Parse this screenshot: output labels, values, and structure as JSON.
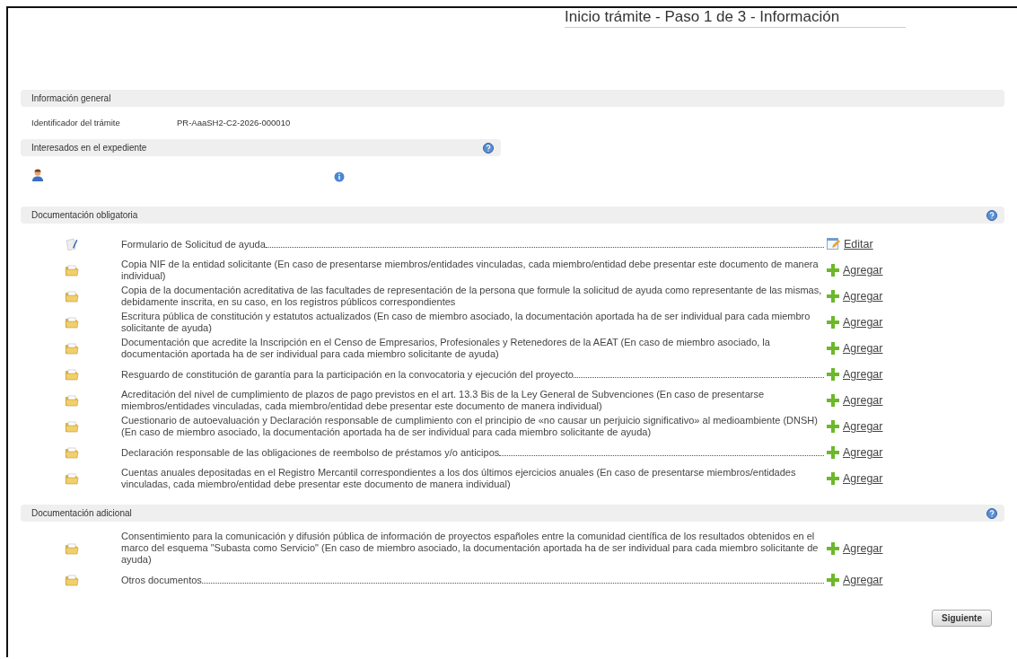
{
  "title": "Inicio trámite - Paso 1 de 3 - Información",
  "general": {
    "heading": "Información general",
    "fields": [
      {
        "label": "Identificador del trámite",
        "value": "PR-AaaSH2-C2-2026-000010"
      }
    ]
  },
  "interesados": {
    "heading": "Interesados en el expediente"
  },
  "sections": [
    {
      "heading": "Documentación obligatoria",
      "documents": [
        {
          "kind": "form",
          "text": "Formulario de Solicitud de ayuda",
          "action": {
            "kind": "edit",
            "label": "Editar"
          }
        },
        {
          "kind": "folder",
          "text": "Copia NIF de la entidad solicitante (En caso de presentarse miembros/entidades vinculadas, cada miembro/entidad debe presentar este documento de manera individual)",
          "action": {
            "kind": "add",
            "label": "Agregar"
          }
        },
        {
          "kind": "folder",
          "text": "Copia de la documentación acreditativa de las facultades de representación de la persona que formule la solicitud de ayuda como representante de las mismas, debidamente inscrita, en su caso, en los registros públicos correspondientes",
          "action": {
            "kind": "add",
            "label": "Agregar"
          }
        },
        {
          "kind": "folder",
          "text": "Escritura pública de constitución y estatutos actualizados (En caso de miembro asociado, la documentación aportada ha de ser individual para cada miembro solicitante de ayuda)",
          "action": {
            "kind": "add",
            "label": "Agregar"
          }
        },
        {
          "kind": "folder",
          "text": "Documentación que acredite la Inscripción en el Censo de Empresarios, Profesionales y Retenedores de la AEAT (En caso de miembro asociado, la documentación aportada ha de ser individual para cada miembro solicitante de ayuda)",
          "action": {
            "kind": "add",
            "label": "Agregar"
          }
        },
        {
          "kind": "folder",
          "text": "Resguardo de constitución de garantía para la participación en la convocatoria y ejecución del proyecto",
          "action": {
            "kind": "add",
            "label": "Agregar"
          }
        },
        {
          "kind": "folder",
          "text": "Acreditación del nivel de cumplimiento de plazos de pago previstos en el art. 13.3 Bis de la Ley General de Subvenciones (En caso de presentarse miembros/entidades vinculadas, cada miembro/entidad debe presentar este documento de manera individual)",
          "action": {
            "kind": "add",
            "label": "Agregar"
          }
        },
        {
          "kind": "folder",
          "text": "Cuestionario de autoevaluación y Declaración responsable de cumplimiento con el principio de «no causar un perjuicio significativo» al medioambiente (DNSH) (En caso de miembro asociado, la documentación aportada ha de ser individual para cada miembro solicitante de ayuda)",
          "action": {
            "kind": "add",
            "label": "Agregar"
          }
        },
        {
          "kind": "folder",
          "text": "Declaración responsable de las obligaciones de reembolso de préstamos y/o anticipos",
          "action": {
            "kind": "add",
            "label": "Agregar"
          }
        },
        {
          "kind": "folder",
          "text": "Cuentas anuales depositadas en el Registro Mercantil correspondientes a los dos últimos ejercicios anuales (En caso de presentarse miembros/entidades vinculadas, cada miembro/entidad debe presentar este documento de manera individual)",
          "action": {
            "kind": "add",
            "label": "Agregar"
          }
        }
      ]
    },
    {
      "heading": "Documentación adicional",
      "documents": [
        {
          "kind": "folder",
          "text": "Consentimiento para la comunicación y difusión pública de información de proyectos españoles entre la comunidad científica de los resultados obtenidos en el marco del esquema \"Subasta como Servicio\" (En caso de miembro asociado, la documentación aportada ha de ser individual para cada miembro solicitante de ayuda)",
          "action": {
            "kind": "add",
            "label": "Agregar"
          }
        },
        {
          "kind": "folder",
          "text": "Otros documentos",
          "action": {
            "kind": "add",
            "label": "Agregar"
          }
        }
      ]
    }
  ],
  "next_button": "Siguiente"
}
